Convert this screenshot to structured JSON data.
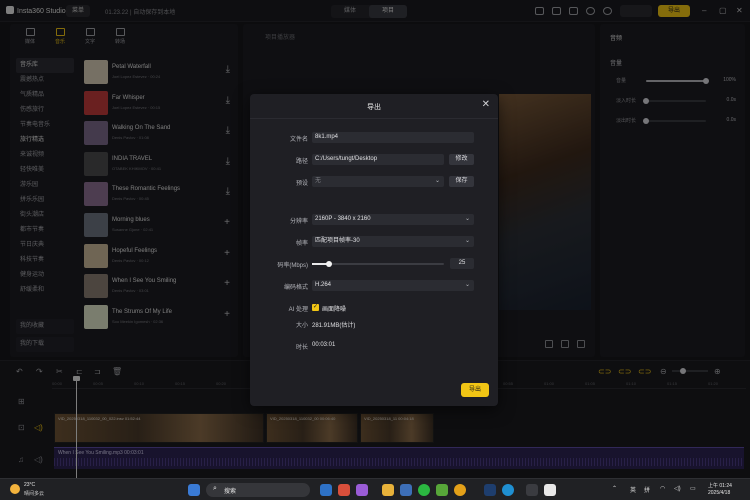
{
  "app": {
    "name": "Insta360 Studio",
    "menu": "菜单",
    "project": "01.23.22 | 自动保存到本地"
  },
  "mode": {
    "left": "媒体",
    "right": "项目"
  },
  "toolbar": {
    "export_label": "导出"
  },
  "library": {
    "tabs": [
      {
        "label": "媒体"
      },
      {
        "label": "音乐"
      },
      {
        "label": "文字"
      },
      {
        "label": "转场"
      }
    ],
    "categories": [
      "音乐库",
      "震撼热点",
      "气质精品",
      "伤感旅行",
      "节奏电音乐",
      "旅行精选",
      "来诚视频",
      "轻快唯美",
      "游乐园",
      "拼乐乐园",
      "街头潮店",
      "都市节奏",
      "节日庆典",
      "科技节奏",
      "健身运动",
      "舒缓柔和"
    ],
    "selected_category": "旅行精选",
    "bottom": [
      "我的收藏",
      "我的下载"
    ],
    "tracks": [
      {
        "title": "Petal Waterfall",
        "meta": "Joel Lopez Estevez · 00:24",
        "action": "⤓"
      },
      {
        "title": "Far Whisper",
        "meta": "Joel Lopez Estevez · 00:15",
        "action": "⤓"
      },
      {
        "title": "Walking On The Sand",
        "meta": "Denis Pavlov · 01:08",
        "action": "⤓"
      },
      {
        "title": "INDIA TRAVEL",
        "meta": "OTABEK KHIKMOV · 00:41",
        "action": "⤓"
      },
      {
        "title": "These Romantic Feelings",
        "meta": "Denis Pavlov · 00:45",
        "action": "⤓"
      },
      {
        "title": "Morning blues",
        "meta": "Susanne Gjone · 02:41",
        "action": "+"
      },
      {
        "title": "Hopeful Feelings",
        "meta": "Denis Pavlov · 00:12",
        "action": "+"
      },
      {
        "title": "When I See You Smiling",
        "meta": "Denis Pavlov · 03:01",
        "action": "+"
      },
      {
        "title": "The Strums Of My Life",
        "meta": "Soo Meekin Igomesh · 02:36",
        "action": "+"
      }
    ]
  },
  "player": {
    "header": "项目播放器"
  },
  "properties": {
    "title": "音频",
    "section": "音量",
    "rows": [
      {
        "label": "音量",
        "value": "100%",
        "level": 1.0
      },
      {
        "label": "淡入时长",
        "value": "0.0s",
        "level": 0.0
      },
      {
        "label": "淡出时长",
        "value": "0.0s",
        "level": 0.0
      }
    ]
  },
  "timeline": {
    "ruler": [
      "00:00",
      "00:05",
      "00:10",
      "00:15",
      "00:20",
      "00:25",
      "00:30",
      "00:35",
      "00:40",
      "00:45",
      "00:50",
      "00:55",
      "01:00",
      "01:05",
      "01:10",
      "01:15",
      "01:20"
    ],
    "clips": [
      {
        "label": "VID_20250318_110032_00_022.insv  01:52:44"
      },
      {
        "label": "VID_20250318_110032_00  00:06:40"
      },
      {
        "label": "VID_20250318_11  00:04:18"
      }
    ],
    "audio": {
      "label": "When I See You Smiling.mp3  00:03:01"
    }
  },
  "export_dialog": {
    "title": "导出",
    "filename_label": "文件名",
    "filename": "8k1.mp4",
    "path_label": "路径",
    "path": "C:/Users/tungt/Desktop",
    "modify": "修改",
    "preset_label": "预设",
    "preset": "无",
    "save": "保存",
    "resolution_label": "分辨率",
    "resolution": "2160P - 3840 x 2160",
    "fps_label": "帧率",
    "fps": "匹配项目帧率-30",
    "bitrate_label": "码率(Mbps)",
    "bitrate": "25",
    "bitrate_level": 0.13,
    "codec_label": "编码格式",
    "codec": "H.264",
    "ai_label": "AI 处理",
    "ai_option": "画面降噪",
    "size_label": "大小",
    "size": "281.91MB(估计)",
    "duration_label": "时长",
    "duration": "00:03:01",
    "confirm": "导出"
  },
  "taskbar": {
    "temp": "23°C",
    "weather": "晴间多云",
    "search": "搜索",
    "lang1": "英",
    "lang2": "拼",
    "time": "上午 01:24",
    "date": "2025/4/18"
  },
  "colors": {
    "accent": "#f1c515",
    "audio_track": "#2d2453"
  }
}
